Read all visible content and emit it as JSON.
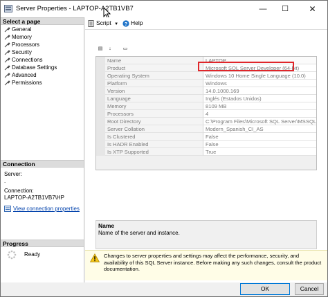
{
  "window": {
    "title": "Server Properties - LAPTOP-A2TB1VB7",
    "controls": {
      "minimize": "—",
      "maximize": "☐",
      "close": "✕"
    }
  },
  "sidebar": {
    "select_page_header": "Select a page",
    "pages": [
      {
        "label": "General",
        "icon": "wrench-icon"
      },
      {
        "label": "Memory",
        "icon": "wrench-icon"
      },
      {
        "label": "Processors",
        "icon": "wrench-icon"
      },
      {
        "label": "Security",
        "icon": "wrench-icon"
      },
      {
        "label": "Connections",
        "icon": "wrench-icon"
      },
      {
        "label": "Database Settings",
        "icon": "wrench-icon"
      },
      {
        "label": "Advanced",
        "icon": "wrench-icon"
      },
      {
        "label": "Permissions",
        "icon": "wrench-icon"
      }
    ],
    "connection_header": "Connection",
    "server_label": "Server:",
    "server_value": ".",
    "connection_label": "Connection:",
    "connection_value": "LAPTOP-A2TB1VB7\\HP",
    "view_connection_link": "View connection properties",
    "progress_header": "Progress",
    "progress_status": "Ready"
  },
  "toolbar": {
    "script_label": "Script",
    "help_label": "Help"
  },
  "grid": {
    "rows": [
      {
        "name": "Name",
        "value": "LAPTOP"
      },
      {
        "name": "Product",
        "value": "Microsoft SQL Server Developer (64-bit)"
      },
      {
        "name": "Operating System",
        "value": "Windows 10 Home Single Language (10.0)"
      },
      {
        "name": "Platform",
        "value": "Windows"
      },
      {
        "name": "Version",
        "value": "14.0.1000.169"
      },
      {
        "name": "Language",
        "value": "Inglés (Estados Unidos)"
      },
      {
        "name": "Memory",
        "value": "8109 MB"
      },
      {
        "name": "Processors",
        "value": "4"
      },
      {
        "name": "Root Directory",
        "value": "C:\\Program Files\\Microsoft SQL Server\\MSSQL14"
      },
      {
        "name": "Server Collation",
        "value": "Modern_Spanish_CI_AS"
      },
      {
        "name": "Is Clustered",
        "value": "False"
      },
      {
        "name": "Is HADR Enabled",
        "value": "False"
      },
      {
        "name": "Is XTP Supported",
        "value": "True"
      }
    ]
  },
  "description": {
    "title": "Name",
    "text": "Name of the server and instance."
  },
  "warning": {
    "text": "Changes to server properties and settings may affect the performance, security, and availability of this SQL Server instance. Before making any such changes, consult the product documentation."
  },
  "buttons": {
    "ok": "OK",
    "cancel": "Cancel"
  },
  "colors": {
    "highlight": "#e0262a",
    "link": "#0645ad",
    "ok_border": "#0078d7"
  }
}
